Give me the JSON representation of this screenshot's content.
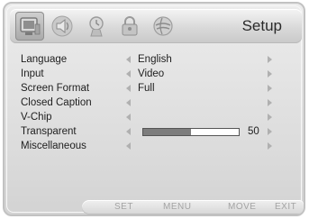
{
  "header": {
    "title": "Setup"
  },
  "tabs": [
    {
      "name": "picture",
      "icon": "picture-icon",
      "selected": true
    },
    {
      "name": "sound",
      "icon": "sound-icon",
      "selected": false
    },
    {
      "name": "time",
      "icon": "time-icon",
      "selected": false
    },
    {
      "name": "lock",
      "icon": "lock-icon",
      "selected": false
    },
    {
      "name": "setup",
      "icon": "setup-icon",
      "selected": false
    }
  ],
  "menu": {
    "items": [
      {
        "label": "Language",
        "value": "English"
      },
      {
        "label": "Input",
        "value": "Video"
      },
      {
        "label": "Screen Format",
        "value": "Full"
      },
      {
        "label": "Closed Caption",
        "value": ""
      },
      {
        "label": "V-Chip",
        "value": ""
      },
      {
        "label": "Transparent",
        "value": "50",
        "level_percent": 50
      },
      {
        "label": "Miscellaneous",
        "value": ""
      }
    ]
  },
  "footer": {
    "set": "SET",
    "menu": "MENU",
    "move": "MOVE",
    "exit": "EXIT"
  },
  "colors": {
    "frame_bg": "#e4e4e4",
    "text": "#1e1e1e",
    "arrow": "#b0b0b0",
    "slider_fill": "#7d7d7d",
    "footer_text": "#a3a3a3"
  }
}
